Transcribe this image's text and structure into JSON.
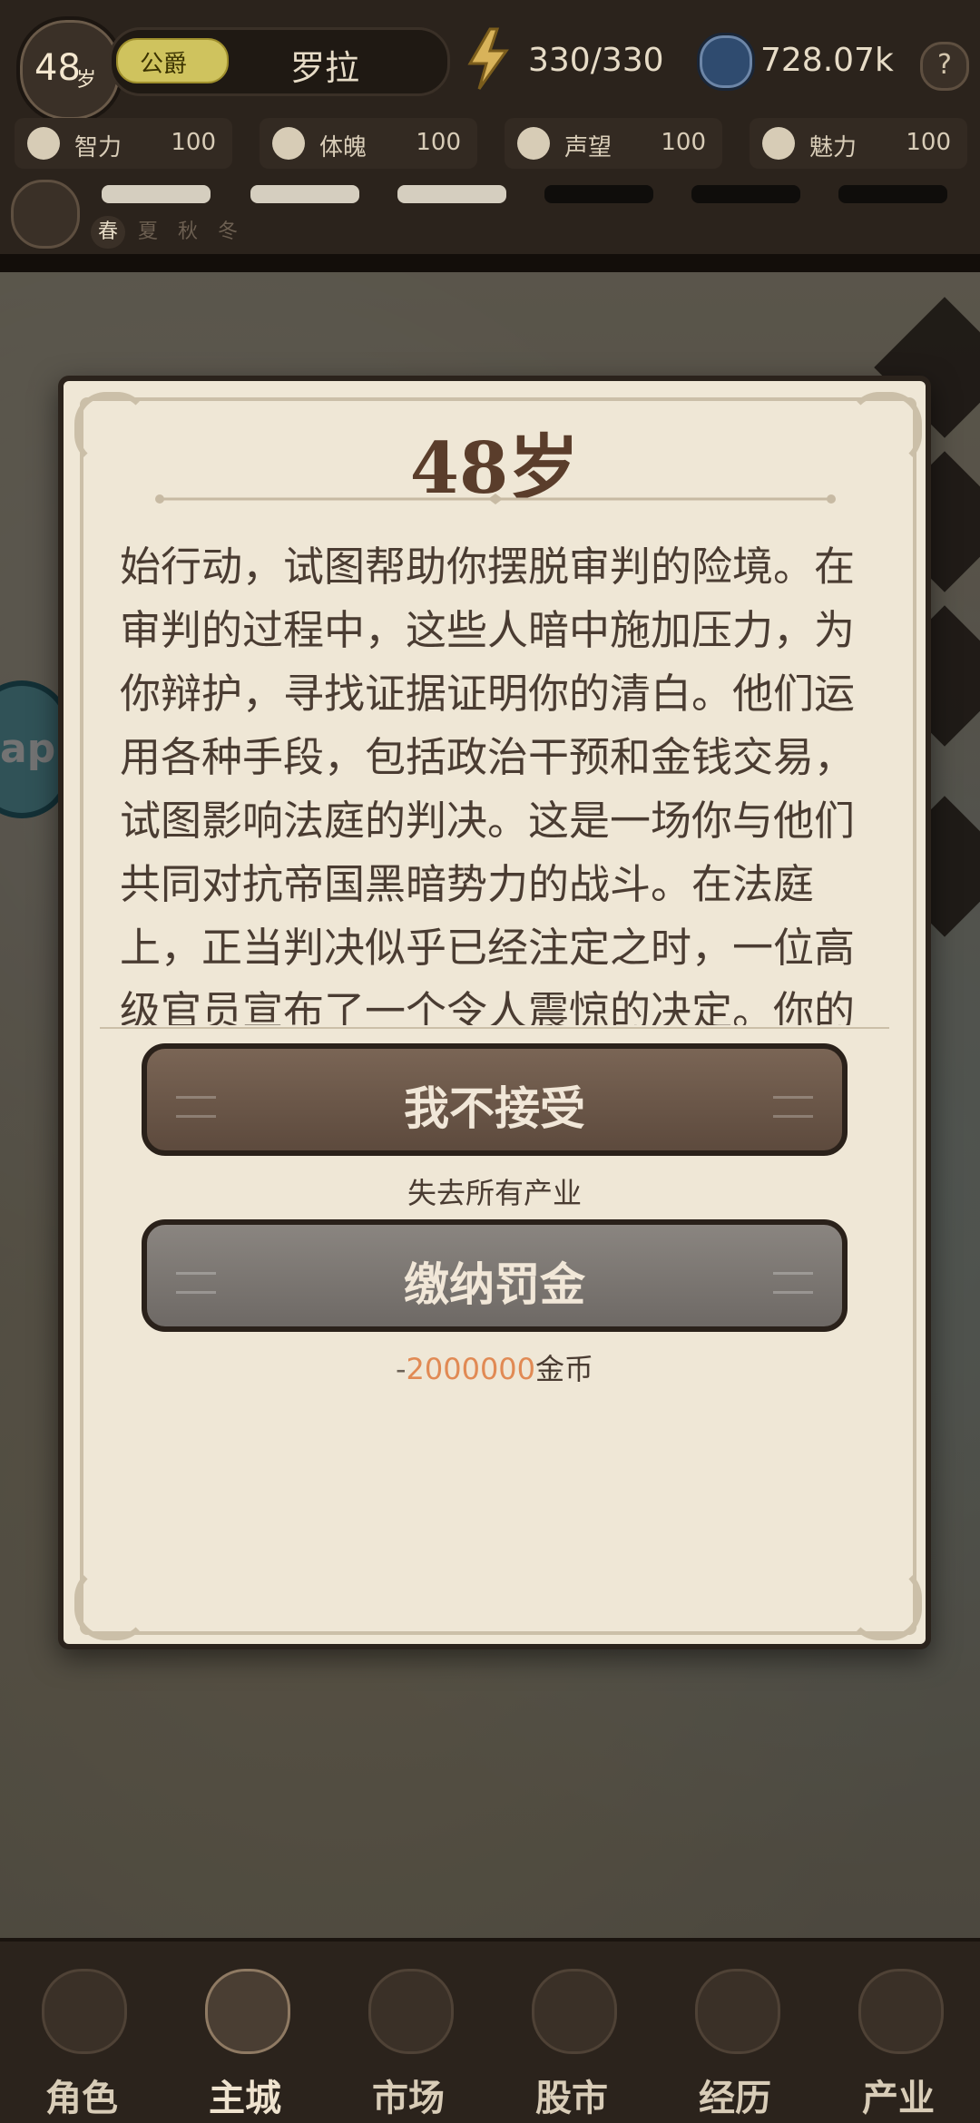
{
  "hud": {
    "age_number": "48",
    "age_unit": "岁",
    "rank": "公爵",
    "name": "罗拉",
    "energy": "330/330",
    "coins": "728.07k",
    "help_icon": "?",
    "stats": [
      {
        "label": "智力",
        "value": "100"
      },
      {
        "label": "体魄",
        "value": "100"
      },
      {
        "label": "声望",
        "value": "100"
      },
      {
        "label": "魅力",
        "value": "100"
      }
    ],
    "season_labels": [
      "春",
      "夏",
      "秋",
      "冬"
    ],
    "active_season": "春"
  },
  "modal": {
    "title": "48岁",
    "story": "始行动，试图帮助你摆脱审判的险境。在审判的过程中，这些人暗中施加压力，为你辩护，寻找证据证明你的清白。他们运用各种手段，包括政治干预和金钱交易，试图影响法庭的判决。这是一场你与他们共同对抗帝国黑暗势力的战斗。在法庭上，正当判决似乎已经注定之时，一位高级官员宣布了一个令人震惊的决定。你的刑罚被大幅减轻，最终免去了牢狱之灾。",
    "choices": [
      {
        "label": "我不接受",
        "subtext": "失去所有产业"
      },
      {
        "label": "缴纳罚金",
        "cost_prefix": "-",
        "cost_amount": "2000000",
        "cost_unit": "金币"
      }
    ]
  },
  "side": {
    "left_text": "ap"
  },
  "bottom_nav": {
    "items": [
      {
        "label": "角色",
        "icon": "character-icon"
      },
      {
        "label": "主城",
        "icon": "castle-icon"
      },
      {
        "label": "市场",
        "icon": "scale-icon"
      },
      {
        "label": "股市",
        "icon": "stock-icon"
      },
      {
        "label": "经历",
        "icon": "scroll-icon"
      },
      {
        "label": "产业",
        "icon": "coins-icon"
      }
    ],
    "active": "主城"
  },
  "colors": {
    "modal_bg": "#efe7d6",
    "primary_button": "#6b5646",
    "secondary_button": "#7c7772",
    "accent_orange": "#e18a54"
  }
}
